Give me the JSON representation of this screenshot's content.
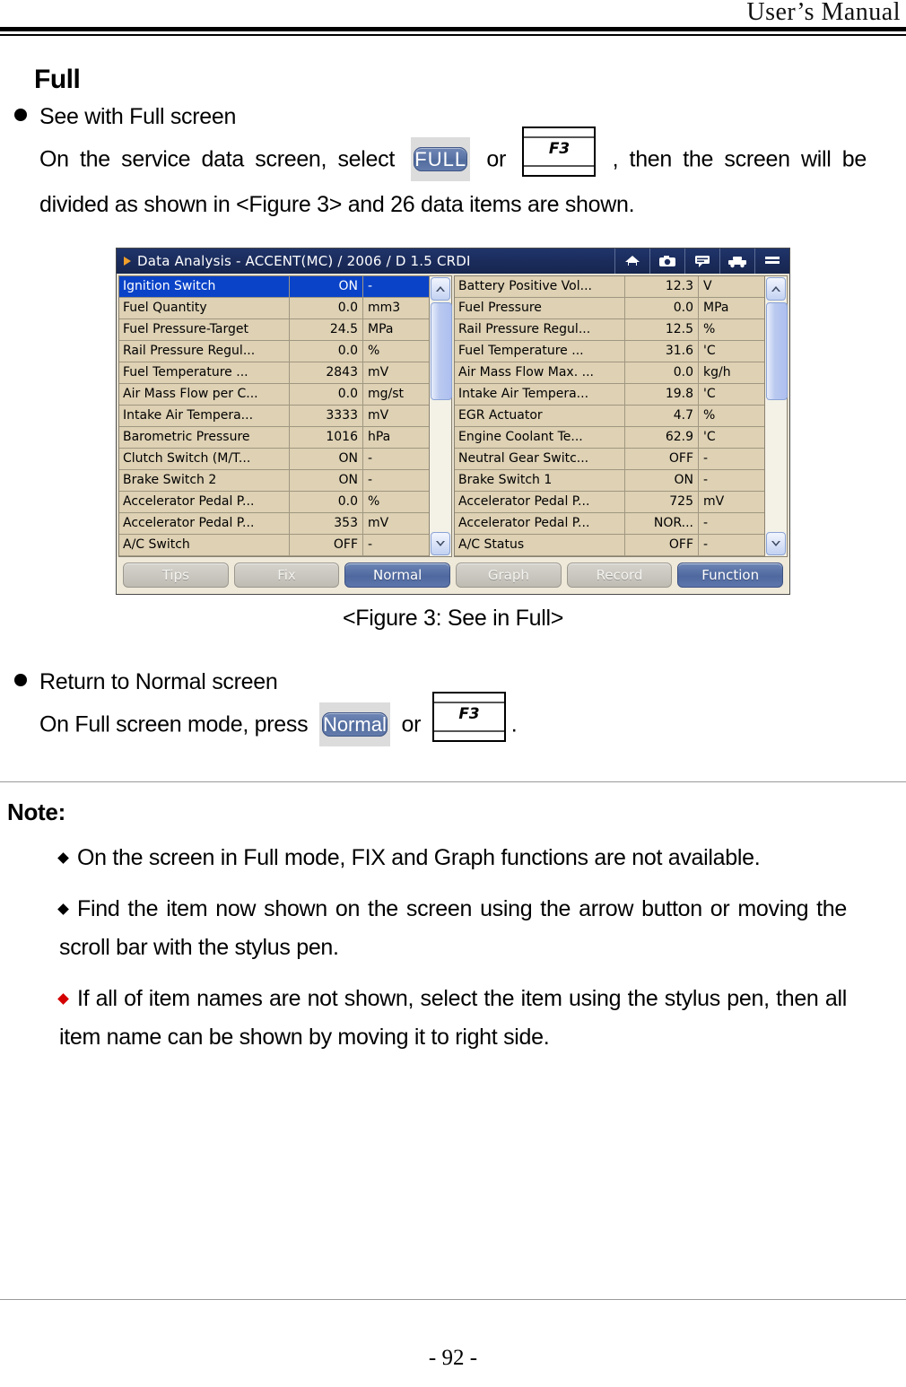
{
  "header": {
    "title": "User’s Manual"
  },
  "section": {
    "heading": "Full"
  },
  "bullets": {
    "see_full": "See with Full screen",
    "return_normal": "Return to Normal screen"
  },
  "paragraphs": {
    "full_text_1": "On  the  service  data  screen,  select",
    "full_text_2": "or",
    "full_text_3": ",  then  the  screen  will  be  divided  as  shown  in  <Figure 3>  and  26  data  items  are  shown.",
    "normal_text_1": "On Full screen mode, press",
    "normal_text_2": "or",
    "normal_text_3": "."
  },
  "inline_buttons": {
    "full_label": "FULL",
    "normal_label": "Normal",
    "fkey_label": "F3"
  },
  "figure": {
    "caption": "<Figure 3: See in Full>",
    "titlebar": {
      "text": "Data Analysis - ACCENT(MC) / 2006 / D 1.5 CRDI",
      "icons": [
        "home-icon",
        "camera-icon",
        "speech-bubble-icon",
        "car-icon",
        "menu-icon"
      ]
    },
    "left_panel": {
      "rows": [
        {
          "name": "Ignition Switch",
          "value": "ON",
          "unit": "-",
          "selected": true
        },
        {
          "name": "Fuel Quantity",
          "value": "0.0",
          "unit": "mm3",
          "selected": false
        },
        {
          "name": "Fuel Pressure-Target",
          "value": "24.5",
          "unit": "MPa",
          "selected": false
        },
        {
          "name": "Rail Pressure Regul...",
          "value": "0.0",
          "unit": "%",
          "selected": false
        },
        {
          "name": "Fuel Temperature ...",
          "value": "2843",
          "unit": "mV",
          "selected": false
        },
        {
          "name": "Air Mass Flow per C...",
          "value": "0.0",
          "unit": "mg/st",
          "selected": false
        },
        {
          "name": "Intake Air Tempera...",
          "value": "3333",
          "unit": "mV",
          "selected": false
        },
        {
          "name": "Barometric Pressure",
          "value": "1016",
          "unit": "hPa",
          "selected": false
        },
        {
          "name": "Clutch Switch (M/T...",
          "value": "ON",
          "unit": "-",
          "selected": false
        },
        {
          "name": "Brake Switch 2",
          "value": "ON",
          "unit": "-",
          "selected": false
        },
        {
          "name": "Accelerator Pedal P...",
          "value": "0.0",
          "unit": "%",
          "selected": false
        },
        {
          "name": "Accelerator Pedal P...",
          "value": "353",
          "unit": "mV",
          "selected": false
        },
        {
          "name": "A/C Switch",
          "value": "OFF",
          "unit": "-",
          "selected": false
        }
      ]
    },
    "right_panel": {
      "rows": [
        {
          "name": "Battery Positive Vol...",
          "value": "12.3",
          "unit": "V",
          "selected": false
        },
        {
          "name": "Fuel Pressure",
          "value": "0.0",
          "unit": "MPa",
          "selected": false
        },
        {
          "name": "Rail Pressure Regul...",
          "value": "12.5",
          "unit": "%",
          "selected": false
        },
        {
          "name": "Fuel Temperature ...",
          "value": "31.6",
          "unit": "'C",
          "selected": false
        },
        {
          "name": "Air Mass Flow Max. ...",
          "value": "0.0",
          "unit": "kg/h",
          "selected": false
        },
        {
          "name": "Intake Air Tempera...",
          "value": "19.8",
          "unit": "'C",
          "selected": false
        },
        {
          "name": "EGR Actuator",
          "value": "4.7",
          "unit": "%",
          "selected": false
        },
        {
          "name": "Engine Coolant Te...",
          "value": "62.9",
          "unit": "'C",
          "selected": false
        },
        {
          "name": "Neutral Gear Switc...",
          "value": "OFF",
          "unit": "-",
          "selected": false
        },
        {
          "name": "Brake Switch 1",
          "value": "ON",
          "unit": "-",
          "selected": false
        },
        {
          "name": "Accelerator Pedal P...",
          "value": "725",
          "unit": "mV",
          "selected": false
        },
        {
          "name": "Accelerator Pedal P...",
          "value": "NOR...",
          "unit": "-",
          "selected": false
        },
        {
          "name": "A/C Status",
          "value": "OFF",
          "unit": "-",
          "selected": false
        }
      ]
    },
    "footer_buttons": [
      {
        "label": "Tips",
        "active": false
      },
      {
        "label": "Fix",
        "active": false
      },
      {
        "label": "Normal",
        "active": true
      },
      {
        "label": "Graph",
        "active": false
      },
      {
        "label": "Record",
        "active": false
      },
      {
        "label": "Function",
        "active": true
      }
    ]
  },
  "note": {
    "title": "Note:",
    "items": [
      {
        "text": "On  the  screen  in  Full  mode,  FIX  and  Graph  functions  are  not available.",
        "bullet_color": "#000000"
      },
      {
        "text": "Find the item now shown on the screen using the arrow button or moving the scroll bar with the stylus pen.",
        "bullet_color": "#000000"
      },
      {
        "text": "If  all  of  item  names  are  not  shown,  select  the  item  using  the stylus  pen,  then  all  item  name  can  be  shown  by  moving  it  to  right side.",
        "bullet_color": "#d40000"
      }
    ]
  },
  "footer": {
    "page_number": "- 92 -"
  }
}
